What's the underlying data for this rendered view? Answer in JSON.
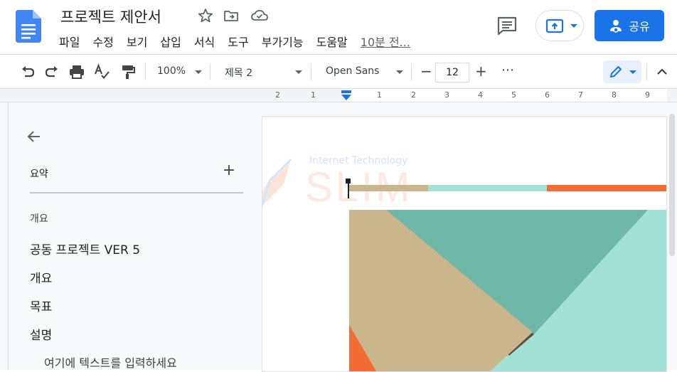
{
  "doc": {
    "title": "프로젝트 제안서",
    "last_edit": "10분 전..."
  },
  "menu": [
    "파일",
    "수정",
    "보기",
    "삽입",
    "서식",
    "도구",
    "부가기능",
    "도움말"
  ],
  "share": {
    "label": "공유"
  },
  "toolbar": {
    "zoom": "100%",
    "style": "제목 2",
    "font": "Open Sans",
    "font_size": "12",
    "minus": "−",
    "plus": "+",
    "more": "⋯"
  },
  "ruler": {
    "labels": [
      "2",
      "1",
      "1",
      "2",
      "3",
      "4",
      "5",
      "6",
      "7",
      "8",
      "9"
    ]
  },
  "outline": {
    "summary_label": "요약",
    "add_label": "+",
    "overview_label": "개요",
    "items": [
      {
        "text": "공동 프로젝트 VER 5"
      },
      {
        "text": "개요"
      },
      {
        "text": "목표"
      },
      {
        "text": "설명"
      },
      {
        "text": "여기에 텍스트를 입력하세요"
      }
    ]
  },
  "watermark": {
    "top": "Internet Technology",
    "main": "SLIM"
  },
  "colors": {
    "brand_blue": "#1a73e8",
    "tan": "#c9b68c",
    "teal": "#a3e0d5",
    "orange": "#f26d35",
    "dark_teal": "#6db8a8",
    "brown": "#5c4e3c"
  }
}
